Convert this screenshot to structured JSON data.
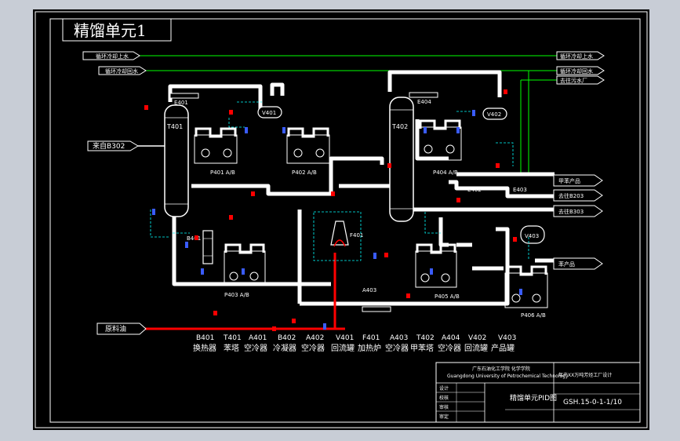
{
  "title": "精馏单元1",
  "colors": {
    "background": "#000000",
    "frame": "#ffffff",
    "green": "#00ff00",
    "cyan": "#00ffff",
    "red": "#ff0000",
    "blue": "#3a5cff",
    "pipe": "#ffffff"
  },
  "top_lines": [
    "循环冷却上水",
    "循环冷却回水",
    "去往污水厂"
  ],
  "input_feed": "来自B302",
  "raw_material": "原料油",
  "outputs": [
    "甲苯产品",
    "去往B203",
    "去往B303",
    "苯产品"
  ],
  "equipment_tags": {
    "T401": "T401",
    "T402": "T402",
    "V401": "V401",
    "V402": "V402",
    "V403": "V403",
    "E401": "E401",
    "E402": "E402",
    "E403": "E403",
    "E404": "E404",
    "B401": "B401",
    "F401": "F401",
    "A403": "A403",
    "P401": "P401 A/B",
    "P402": "P402 A/B",
    "P403": "P403 A/B",
    "P404": "P404 A/B",
    "P405": "P405 A/B",
    "P406": "P406 A/B"
  },
  "legend": [
    {
      "code": "B401",
      "name": "换热器"
    },
    {
      "code": "T401",
      "name": "苯塔"
    },
    {
      "code": "A401",
      "name": "空冷器"
    },
    {
      "code": "B402",
      "name": "冷凝器"
    },
    {
      "code": "A402",
      "name": "空冷器"
    },
    {
      "code": "V401",
      "name": "回流罐"
    },
    {
      "code": "F401",
      "name": "加热炉"
    },
    {
      "code": "A403",
      "name": "空冷器"
    },
    {
      "code": "T402",
      "name": "甲苯塔"
    },
    {
      "code": "A404",
      "name": "空冷器"
    },
    {
      "code": "V402",
      "name": "回流罐"
    },
    {
      "code": "V403",
      "name": "产品罐"
    }
  ],
  "title_block": {
    "school_cn": "广东石油化工学院 化学学院",
    "school_en": "Guangdong University of Petrochemical Technology",
    "project": "年产XX万吨芳烃工厂设计",
    "drawing_name": "精馏单元PID图",
    "drawing_no": "GSH.15-0-1-1/10",
    "rows": [
      "设计",
      "校核",
      "审核",
      "审定"
    ]
  }
}
